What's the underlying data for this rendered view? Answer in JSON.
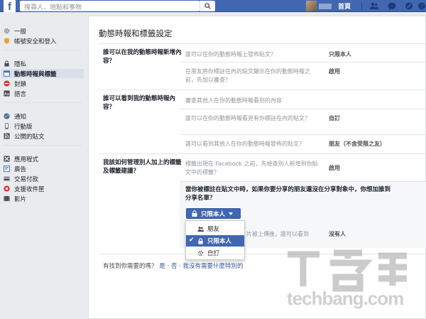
{
  "topbar": {
    "logo_letter": "f",
    "search_placeholder": "搜尋人、地點和事物",
    "home_label": "首頁",
    "brand_color": "#4267b2"
  },
  "sidebar": {
    "items": [
      {
        "label": "一般",
        "icon": "gear-icon"
      },
      {
        "label": "帳號安全和登入",
        "icon": "shield-icon"
      },
      {
        "label": "隱私",
        "icon": "lock-icon"
      },
      {
        "label": "動態時報與標籤",
        "icon": "timeline-icon",
        "active": true
      },
      {
        "label": "封鎖",
        "icon": "block-icon"
      },
      {
        "label": "語言",
        "icon": "language-icon"
      },
      {
        "label": "通知",
        "icon": "globe-icon"
      },
      {
        "label": "行動版",
        "icon": "mobile-icon"
      },
      {
        "label": "公開的貼文",
        "icon": "rss-icon"
      },
      {
        "label": "應用程式",
        "icon": "apps-icon"
      },
      {
        "label": "廣告",
        "icon": "ads-icon"
      },
      {
        "label": "交易付款",
        "icon": "payment-icon"
      },
      {
        "label": "支援收件匣",
        "icon": "inbox-icon"
      },
      {
        "label": "影片",
        "icon": "video-icon"
      }
    ]
  },
  "main": {
    "title": "動態時報和標籤設定",
    "sections": [
      {
        "heading": "誰可以在我的動態時報新增內容？",
        "rows": [
          {
            "text": "誰可以在你的動態時報上發佈貼文？",
            "value": "只限本人"
          },
          {
            "text": "在朋友將你標註在內的貼文顯示在你的動態時報之前，先加以審查？",
            "value": "啟用"
          }
        ]
      },
      {
        "heading": "誰可以看到我的動態時報內容？",
        "rows": [
          {
            "text": "審查其他人在你的動態時報看到的內容",
            "value": ""
          },
          {
            "text": "誰可以在你的動態時報看見有你標註在內的貼文？",
            "value": "自訂"
          },
          {
            "text": "誰可以看到其他人在你的動態時報發佈的貼文？",
            "value": "朋友（不含受限之友）"
          }
        ]
      },
      {
        "heading": "我該如何管理別人加上的標籤及標籤建議？",
        "rows": [
          {
            "text": "標籤出現在 Facebook 之前，先檢查別人新增到你貼文中的標籤？",
            "value": "啟用"
          }
        ],
        "edit_question": "當你被標註在貼文中時，如果你要分享的朋友還沒在分享對象中，你想加誰到分享名單？",
        "privacy_button": "只限本人",
        "menu_options": [
          {
            "label": "朋友",
            "icon": "friends-icon",
            "selected": false
          },
          {
            "label": "只限本人",
            "icon": "lock-icon",
            "selected": true
          },
          {
            "label": "自訂",
            "icon": "gear-icon",
            "selected": false
          }
        ],
        "hidden_row_text": "片被上傳後，誰可以看到",
        "hidden_row_value": "沒有人"
      }
    ],
    "footer_question": "有找到你需要的嗎？",
    "footer_yes": "是",
    "footer_sep": "·",
    "footer_no": "否",
    "footer_other": "我沒有需要什麼特別的"
  },
  "watermark": {
    "text": "techbang.com"
  }
}
